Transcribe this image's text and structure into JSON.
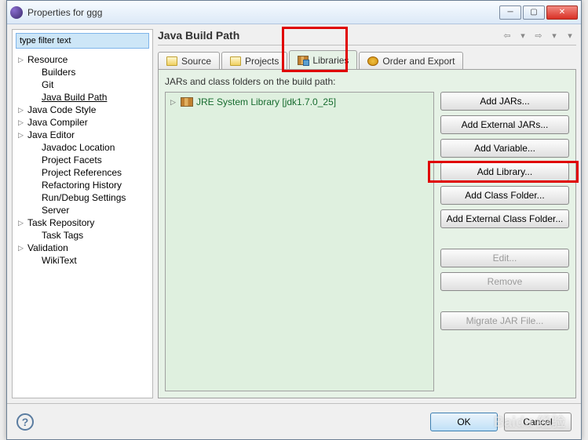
{
  "window": {
    "title": "Properties for ggg"
  },
  "filter": {
    "value": "type filter text"
  },
  "tree": {
    "items": [
      {
        "label": "Resource",
        "expandable": true,
        "indent": false
      },
      {
        "label": "Builders",
        "expandable": false,
        "indent": true
      },
      {
        "label": "Git",
        "expandable": false,
        "indent": true
      },
      {
        "label": "Java Build Path",
        "expandable": false,
        "indent": true,
        "selected": true
      },
      {
        "label": "Java Code Style",
        "expandable": true,
        "indent": false
      },
      {
        "label": "Java Compiler",
        "expandable": true,
        "indent": false
      },
      {
        "label": "Java Editor",
        "expandable": true,
        "indent": false
      },
      {
        "label": "Javadoc Location",
        "expandable": false,
        "indent": true
      },
      {
        "label": "Project Facets",
        "expandable": false,
        "indent": true
      },
      {
        "label": "Project References",
        "expandable": false,
        "indent": true
      },
      {
        "label": "Refactoring History",
        "expandable": false,
        "indent": true
      },
      {
        "label": "Run/Debug Settings",
        "expandable": false,
        "indent": true
      },
      {
        "label": "Server",
        "expandable": false,
        "indent": true
      },
      {
        "label": "Task Repository",
        "expandable": true,
        "indent": false
      },
      {
        "label": "Task Tags",
        "expandable": false,
        "indent": true
      },
      {
        "label": "Validation",
        "expandable": true,
        "indent": false
      },
      {
        "label": "WikiText",
        "expandable": false,
        "indent": true
      }
    ]
  },
  "page": {
    "title": "Java Build Path",
    "tabs": {
      "source": "Source",
      "projects": "Projects",
      "libraries": "Libraries",
      "order": "Order and Export"
    },
    "desc": "JARs and class folders on the build path:",
    "lib_item": "JRE System Library [jdk1.7.0_25]",
    "buttons": {
      "add_jars": "Add JARs...",
      "add_ext_jars": "Add External JARs...",
      "add_variable": "Add Variable...",
      "add_library": "Add Library...",
      "add_class_folder": "Add Class Folder...",
      "add_ext_class_folder": "Add External Class Folder...",
      "edit": "Edit...",
      "remove": "Remove",
      "migrate": "Migrate JAR File..."
    }
  },
  "footer": {
    "ok": "OK",
    "cancel": "Cancel"
  }
}
